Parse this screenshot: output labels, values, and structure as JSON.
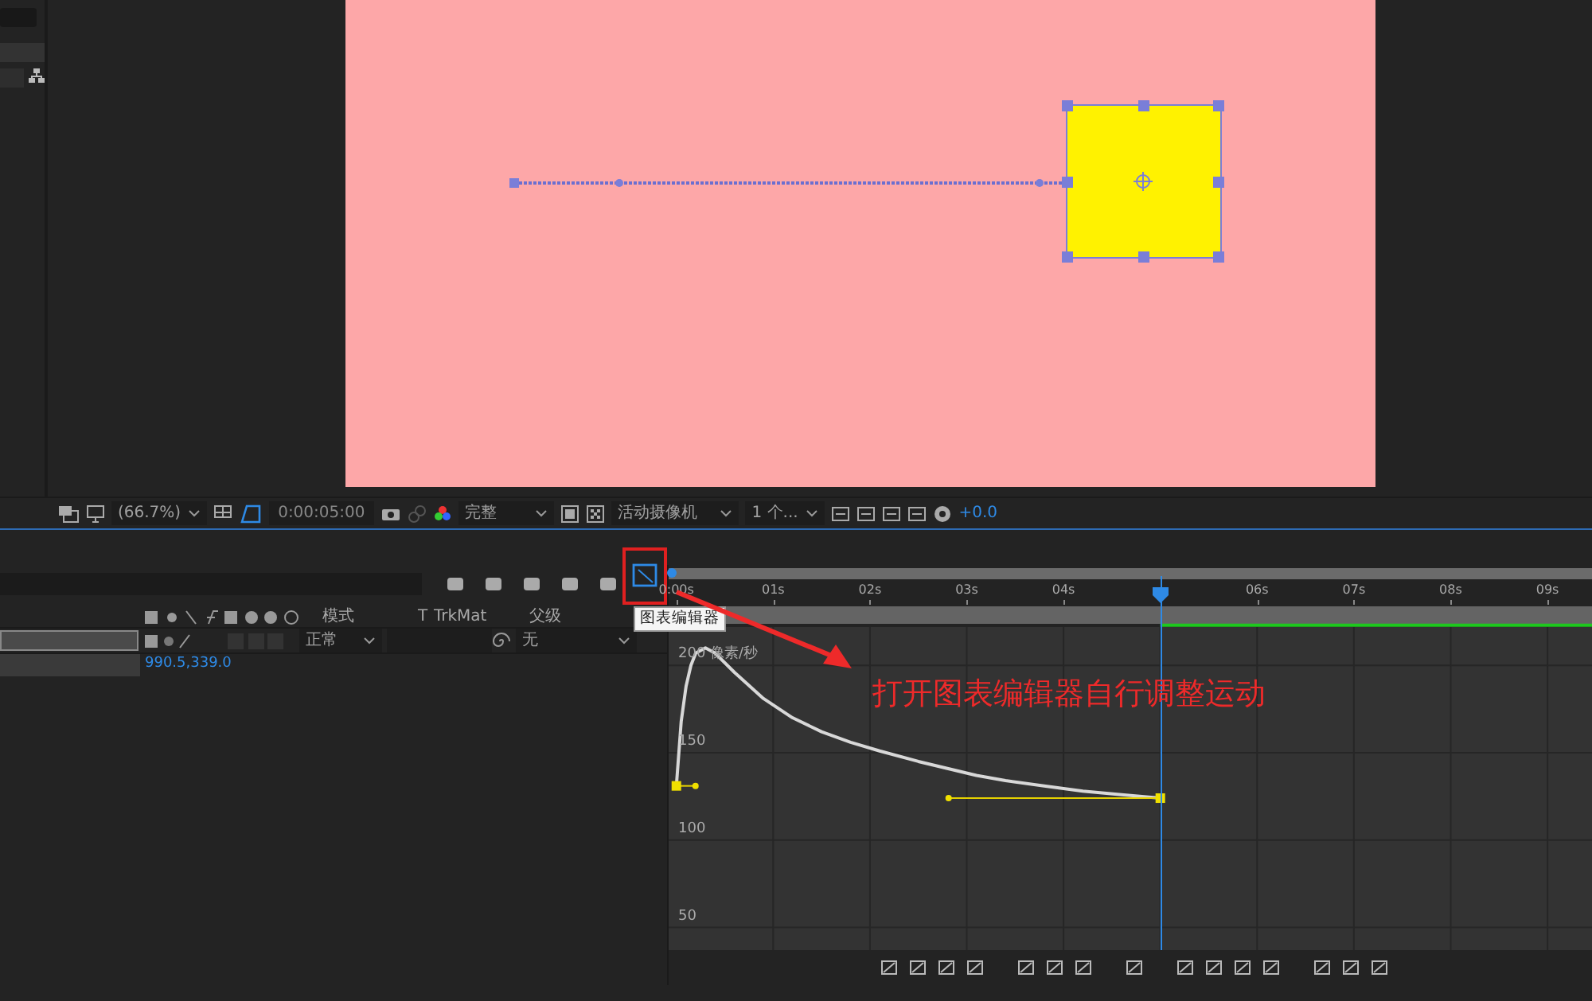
{
  "viewer_toolbar": {
    "magnification": "(66.7%)",
    "timecode": "0:00:05:00",
    "resolution": "完整",
    "camera": "活动摄像机",
    "views": "1 个...",
    "exposure": "+0.0"
  },
  "timeline": {
    "graph_editor": {
      "on": true,
      "tooltip": "图表编辑器"
    },
    "columns": [
      "模式",
      "T",
      "TrkMat",
      "父级"
    ],
    "layer": {
      "mode": "正常",
      "parent": "无",
      "value": "990.5,339.0",
      "switches": [
        {
          "on": false
        },
        {
          "on": false
        },
        {
          "on": false
        }
      ]
    },
    "chart_data": {
      "type": "line",
      "grid": true,
      "xlim": [
        -0.08,
        9.46
      ],
      "ylim": [
        37,
        249.3
      ],
      "ref_lines": [
        {
          "axis": "x",
          "value": 5,
          "color": "#2e8ae6"
        }
      ],
      "bands": [
        {
          "axis": "x",
          "from": -0.08,
          "to": 9.46,
          "color": "#646464"
        }
      ],
      "xticks": [
        {
          "value": 0,
          "label": "0:00s"
        },
        {
          "value": 1,
          "label": "01s"
        },
        {
          "value": 2,
          "label": "02s"
        },
        {
          "value": 3,
          "label": "03s"
        },
        {
          "value": 4,
          "label": "04s"
        },
        {
          "value": 6,
          "label": "06s"
        },
        {
          "value": 7,
          "label": "07s"
        },
        {
          "value": 8,
          "label": "08s"
        },
        {
          "value": 9,
          "label": "09s"
        }
      ],
      "yticks": [
        {
          "value": 200,
          "label": "200 像素/秒"
        },
        {
          "value": 150,
          "label": "150"
        },
        {
          "value": 100,
          "label": "100"
        },
        {
          "value": 50,
          "label": "50"
        }
      ],
      "x": [
        0,
        0.05,
        0.1,
        0.15,
        0.2,
        0.3,
        0.4,
        0.6,
        0.9,
        1.2,
        1.5,
        1.8,
        2.1,
        2.5,
        2.8,
        3.1,
        3.4,
        3.8,
        4.2,
        4.6,
        5,
        9.46
      ],
      "series": [
        {
          "color": "#d8d8d8",
          "values": [
            131,
            168,
            188,
            200,
            207,
            210,
            207,
            196,
            181,
            170,
            162,
            156,
            151,
            145,
            141,
            137,
            134,
            131,
            128,
            126,
            124,
            null
          ]
        },
        {
          "color": "#1ec81e",
          "values": [
            null,
            null,
            null,
            null,
            null,
            null,
            null,
            null,
            null,
            null,
            null,
            null,
            null,
            null,
            null,
            null,
            null,
            null,
            null,
            null,
            223,
            223
          ]
        }
      ]
    }
  },
  "annotation": {
    "text": "打开图表编辑器自行调整运动"
  }
}
